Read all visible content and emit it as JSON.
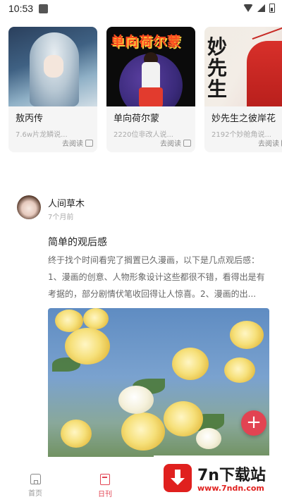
{
  "status_bar": {
    "time": "10:53"
  },
  "recommend_cards": [
    {
      "title": "敖丙传",
      "subtitle": "7.6w片龙鳞说...",
      "read_label": "去阅读"
    },
    {
      "title": "单向荷尔蒙",
      "subtitle": "2220位非改人说...",
      "read_label": "去阅读"
    },
    {
      "title": "妙先生之彼岸花",
      "subtitle": "2192个妙舱角说...",
      "read_label": "去阅读"
    }
  ],
  "cover_art": {
    "card2_title": "单向荷尔蒙",
    "card3_brush": "妙\n先\n生"
  },
  "post": {
    "author": "人间草木",
    "time": "7个月前",
    "title": "简单的观后感",
    "body": "终于找个时间看完了搁置已久漫画，以下是几点观后感：1、漫画的创意、人物形象设计这些都很不错，看得出是有考据的，部分剧情伏笔收回得让人惊喜。2、漫画的出..."
  },
  "fab": {
    "label": "+"
  },
  "bottom_nav": [
    {
      "label": "首页",
      "icon": "home-icon",
      "active": false
    },
    {
      "label": "日刊",
      "icon": "journal-icon",
      "active": true
    }
  ],
  "watermark": {
    "text": "7n下载站",
    "url": "www.7ndn.com"
  },
  "colors": {
    "accent": "#e24352",
    "watermark_red": "#e0201e"
  }
}
